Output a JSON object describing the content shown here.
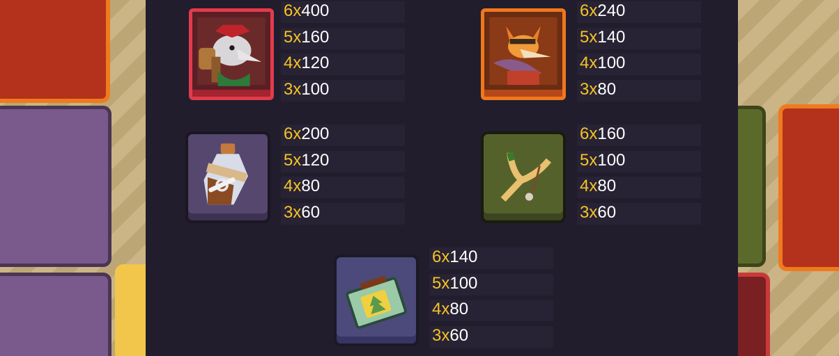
{
  "paytable": {
    "symbols": [
      {
        "name": "wolf-hammer",
        "pays": [
          {
            "count": "6x",
            "value": "400"
          },
          {
            "count": "5x",
            "value": "160"
          },
          {
            "count": "4x",
            "value": "120"
          },
          {
            "count": "3x",
            "value": "100"
          }
        ]
      },
      {
        "name": "fox-lizard",
        "pays": [
          {
            "count": "6x",
            "value": "240"
          },
          {
            "count": "5x",
            "value": "140"
          },
          {
            "count": "4x",
            "value": "100"
          },
          {
            "count": "3x",
            "value": "80"
          }
        ]
      },
      {
        "name": "potion-flask",
        "pays": [
          {
            "count": "6x",
            "value": "200"
          },
          {
            "count": "5x",
            "value": "120"
          },
          {
            "count": "4x",
            "value": "80"
          },
          {
            "count": "3x",
            "value": "60"
          }
        ]
      },
      {
        "name": "slingshot",
        "pays": [
          {
            "count": "6x",
            "value": "160"
          },
          {
            "count": "5x",
            "value": "100"
          },
          {
            "count": "4x",
            "value": "80"
          },
          {
            "count": "3x",
            "value": "60"
          }
        ]
      },
      {
        "name": "matchbox",
        "pays": [
          {
            "count": "6x",
            "value": "140"
          },
          {
            "count": "5x",
            "value": "100"
          },
          {
            "count": "4x",
            "value": "80"
          },
          {
            "count": "3x",
            "value": "60"
          }
        ]
      }
    ]
  },
  "colors": {
    "multiplier": "#f6c228",
    "value": "#ffffff",
    "panel": "#211d2d"
  },
  "icons": [
    "wolf-hammer-icon",
    "fox-lizard-icon",
    "potion-flask-icon",
    "slingshot-icon",
    "matchbox-icon"
  ]
}
